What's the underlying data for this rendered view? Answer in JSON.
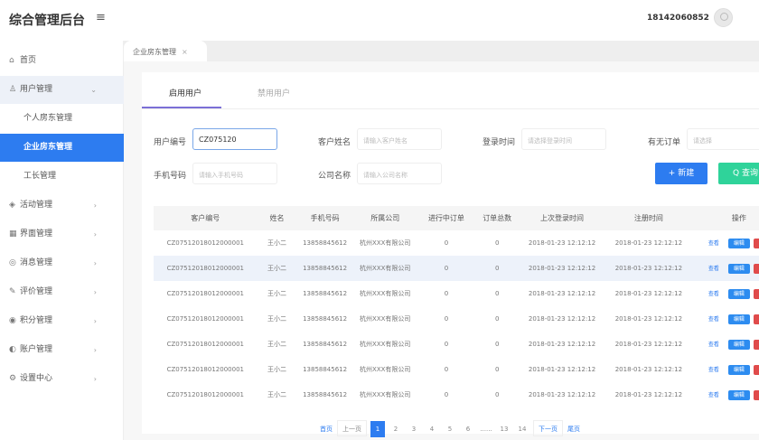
{
  "header": {
    "title": "综合管理后台",
    "user": "18142060852",
    "menu_icon": "hamburger-icon"
  },
  "sidebar": {
    "items": [
      {
        "label": "首页",
        "icon": "home-icon"
      },
      {
        "label": "用户管理",
        "icon": "user-icon",
        "expanded": true
      },
      {
        "label": "个人房东管理",
        "sub": true
      },
      {
        "label": "企业房东管理",
        "sub": true,
        "active": true
      },
      {
        "label": "工长管理",
        "sub": true
      },
      {
        "label": "活动管理",
        "icon": "activity-icon"
      },
      {
        "label": "界面管理",
        "icon": "grid-icon"
      },
      {
        "label": "消息管理",
        "icon": "message-icon"
      },
      {
        "label": "评价管理",
        "icon": "comment-icon"
      },
      {
        "label": "积分管理",
        "icon": "points-icon"
      },
      {
        "label": "账户管理",
        "icon": "account-icon"
      },
      {
        "label": "设置中心",
        "icon": "settings-icon"
      }
    ]
  },
  "page_tab": {
    "label": "企业房东管理",
    "close": "×"
  },
  "sub_tabs": [
    "启用用户",
    "禁用用户"
  ],
  "filters": {
    "user_no": {
      "label": "用户编号",
      "value": "CZ075120"
    },
    "customer_name": {
      "label": "客户姓名",
      "placeholder": "请输入客户姓名"
    },
    "login_time": {
      "label": "登录时间",
      "placeholder": "请选择登录时间"
    },
    "has_order": {
      "label": "有无订单",
      "placeholder": "请选择"
    },
    "phone": {
      "label": "手机号码",
      "placeholder": "请输入手机号码"
    },
    "company": {
      "label": "公司名称",
      "placeholder": "请输入公司名称"
    }
  },
  "buttons": {
    "new": "+ 新建",
    "search": "Q 查询"
  },
  "table": {
    "columns": [
      "客户编号",
      "姓名",
      "手机号码",
      "所属公司",
      "进行中订单",
      "订单总数",
      "上次登录时间",
      "注册时间",
      "操作"
    ],
    "actions": [
      "查看",
      "编辑",
      "禁用"
    ],
    "rows": [
      [
        "CZ07512018012000001",
        "王小二",
        "13858845612",
        "杭州XXX有限公司",
        "0",
        "0",
        "2018-01-23  12:12:12",
        "2018-01-23  12:12:12"
      ],
      [
        "CZ07512018012000001",
        "王小二",
        "13858845612",
        "杭州XXX有限公司",
        "0",
        "0",
        "2018-01-23  12:12:12",
        "2018-01-23  12:12:12"
      ],
      [
        "CZ07512018012000001",
        "王小二",
        "13858845612",
        "杭州XXX有限公司",
        "0",
        "0",
        "2018-01-23  12:12:12",
        "2018-01-23  12:12:12"
      ],
      [
        "CZ07512018012000001",
        "王小二",
        "13858845612",
        "杭州XXX有限公司",
        "0",
        "0",
        "2018-01-23  12:12:12",
        "2018-01-23  12:12:12"
      ],
      [
        "CZ07512018012000001",
        "王小二",
        "13858845612",
        "杭州XXX有限公司",
        "0",
        "0",
        "2018-01-23  12:12:12",
        "2018-01-23  12:12:12"
      ],
      [
        "CZ07512018012000001",
        "王小二",
        "13858845612",
        "杭州XXX有限公司",
        "0",
        "0",
        "2018-01-23  12:12:12",
        "2018-01-23  12:12:12"
      ],
      [
        "CZ07512018012000001",
        "王小二",
        "13858845612",
        "杭州XXX有限公司",
        "0",
        "0",
        "2018-01-23  12:12:12",
        "2018-01-23  12:12:12"
      ]
    ]
  },
  "pagination": {
    "first": "首页",
    "prev": "上一页",
    "pages": [
      "1",
      "2",
      "3",
      "4",
      "5",
      "6",
      "......",
      "13",
      "14"
    ],
    "current": "1",
    "next": "下一页",
    "last": "尾页"
  },
  "colors": {
    "primary": "#2d7cf0",
    "success": "#2fd39a",
    "danger": "#e04b4b",
    "tab_ink": "#7b6fd6"
  }
}
